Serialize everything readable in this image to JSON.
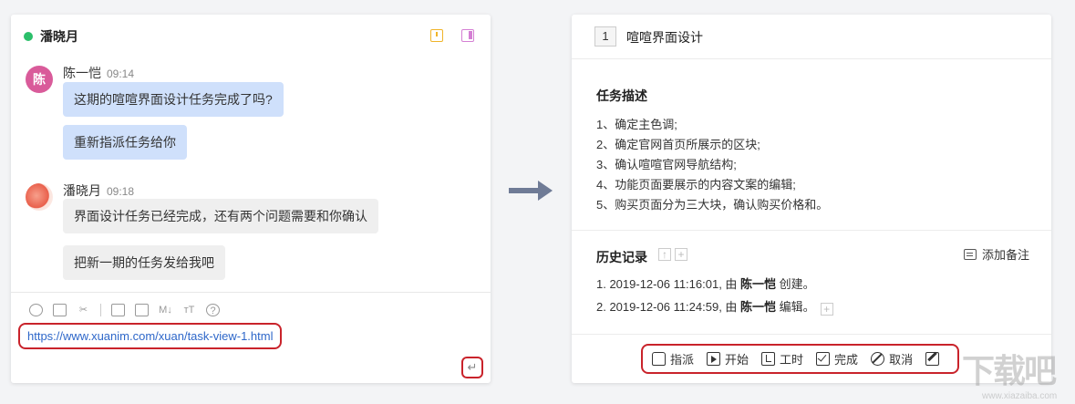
{
  "chat": {
    "title": "潘晓月",
    "messages": [
      {
        "avatar_text": "陈",
        "sender": "陈一恺",
        "time": "09:14",
        "bubbles": [
          "这期的喧喧界面设计任务完成了吗?",
          "重新指派任务给你"
        ]
      },
      {
        "avatar_text": "",
        "sender": "潘晓月",
        "time": "09:18",
        "bubbles": [
          "界面设计任务已经完成，还有两个问题需要和你确认",
          "把新一期的任务发给我吧"
        ]
      }
    ],
    "toolbar_icons": [
      "emoji-icon",
      "image-icon",
      "scissors-icon",
      "folder-icon",
      "code-icon",
      "markdown-icon",
      "font-size-icon",
      "help-icon"
    ],
    "toolbar_glyphs": {
      "markdown": "M↓",
      "font": "тT",
      "help": "?"
    },
    "input_value": "https://www.xuanim.com/xuan/task-view-1.html",
    "send_glyph": "↵"
  },
  "task": {
    "id": "1",
    "title": "喧喧界面设计",
    "description_title": "任务描述",
    "description_lines": [
      "1、确定主色调;",
      "2、确定官网首页所展示的区块;",
      "3、确认喧喧官网导航结构;",
      "4、功能页面要展示的内容文案的编辑;",
      "5、购买页面分为三大块，确认购买价格和。"
    ],
    "history_title": "历史记录",
    "add_note_label": "添加备注",
    "history": [
      {
        "prefix": "1. 2019-12-06 11:16:01, 由 ",
        "actor": "陈一恺",
        "action": " 创建。"
      },
      {
        "prefix": "2. 2019-12-06 11:24:59, 由 ",
        "actor": "陈一恺",
        "action": " 编辑。"
      }
    ],
    "actions": [
      {
        "icon": "thumbs-up-icon",
        "label": "指派"
      },
      {
        "icon": "play-icon",
        "label": "开始"
      },
      {
        "icon": "clock-icon",
        "label": "工时"
      },
      {
        "icon": "checkbox-icon",
        "label": "完成"
      },
      {
        "icon": "cancel-icon",
        "label": "取消"
      },
      {
        "icon": "edit-icon",
        "label": ""
      }
    ]
  },
  "watermark": {
    "logo": "下载吧",
    "url": "www.xiazaiba.com"
  },
  "colors": {
    "online": "#2bbf6a",
    "own_bubble": "#cfe0fb",
    "other_bubble": "#efefef",
    "highlight": "#c9232b",
    "link": "#2e67c9",
    "arrow": "#6f7b96"
  }
}
